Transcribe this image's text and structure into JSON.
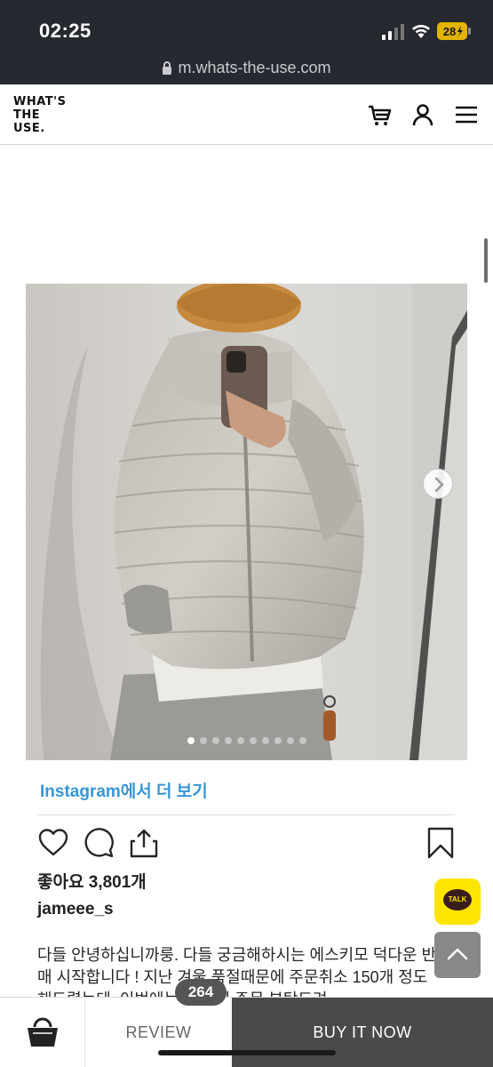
{
  "status_bar": {
    "time": "02:25",
    "battery_level": "28",
    "url": "m.whats-the-use.com"
  },
  "header": {
    "logo_line1": "WHAT'S",
    "logo_line2": "THE",
    "logo_line3": "USE.",
    "icons": [
      "cart-icon",
      "user-icon",
      "menu-icon"
    ]
  },
  "carousel": {
    "dot_count": 10,
    "active_index": 0
  },
  "post": {
    "instagram_link": "Instagram에서 더 보기",
    "likes": "좋아요 3,801개",
    "username": "jameee_s",
    "caption_line1": "다들 안녕하십니까룽. 다들 궁금해하시는 에스키모 덕다운 반",
    "caption_line2": "매 시작합니다 ! 지난 겨울 품절때문에 주문취소 150개 정도",
    "caption_line3": "해드렸는데, 이번에는 ... 미리 주문 부탁드려"
  },
  "floating": {
    "talk_label": "TALK"
  },
  "bottom_bar": {
    "review_label": "REVIEW",
    "review_count": "264",
    "buy_label": "BUY IT NOW"
  },
  "colors": {
    "status_bg": "#262a30",
    "link_blue": "#3796d6",
    "kakao_yellow": "#fee500",
    "buy_bg": "#4a4a4a"
  }
}
